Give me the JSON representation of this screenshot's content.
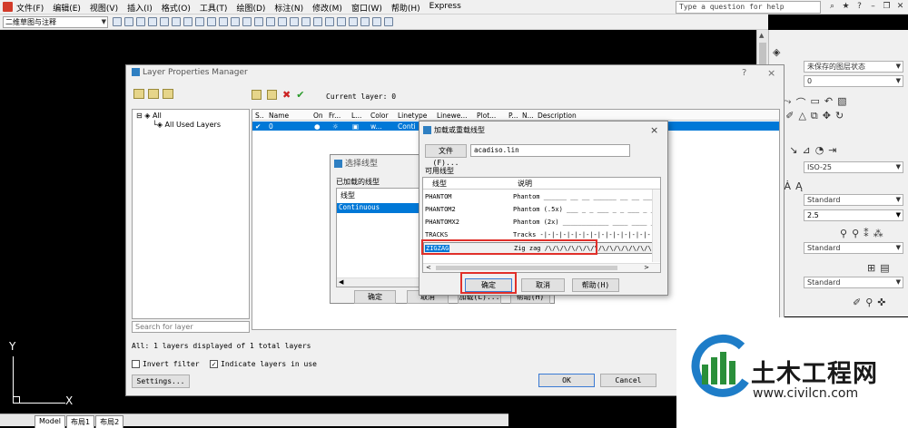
{
  "menubar": {
    "items": [
      "文件(F)",
      "编辑(E)",
      "视图(V)",
      "插入(I)",
      "格式(O)",
      "工具(T)",
      "绘图(D)",
      "标注(N)",
      "修改(M)",
      "窗口(W)",
      "帮助(H)",
      "Express"
    ],
    "help_placeholder": "Type a question for help"
  },
  "toolbar": {
    "workspace": "二维草图与注释"
  },
  "layout_tabs": [
    "Model",
    "布局1",
    "布局2"
  ],
  "axis": {
    "y": "Y",
    "x": "X"
  },
  "right_panel": {
    "layer_state": "未保存的图层状态",
    "layer_value": "0",
    "dim_style": "ISO-25",
    "text_style": "Standard",
    "text_height": "2.5",
    "mleader_style": "Standard",
    "table_style": "Standard"
  },
  "layer_manager": {
    "title": "Layer Properties Manager",
    "help": "?",
    "close": "×",
    "current_layer": "Current layer: 0",
    "tree": {
      "root": "All",
      "child": "All Used Layers"
    },
    "columns": [
      "S..",
      "Name",
      "On",
      "Fr...",
      "L...",
      "Color",
      "Linetype",
      "Linewe...",
      "Plot...",
      "P...",
      "N...",
      "Description"
    ],
    "row": {
      "name": "0",
      "color": "w...",
      "linetype": "Conti"
    },
    "search_placeholder": "Search for layer",
    "status": "All: 1 layers displayed of 1 total layers",
    "invert_filter": "Invert filter",
    "indicate_layers": "Indicate layers in use",
    "settings": "Settings...",
    "ok": "OK",
    "cancel": "Cancel"
  },
  "select_linetype": {
    "title": "选择线型",
    "loaded_label": "已加载的线型",
    "col": "线型",
    "item": "Continuous",
    "buttons": [
      "确定",
      "取消",
      "加载(L)...",
      "帮助(H)"
    ]
  },
  "load_linetype": {
    "title": "加载或重载线型",
    "close": "×",
    "file_button": "文件(F)...",
    "file_name": "acadiso.lin",
    "available": "可用线型",
    "col_linetype": "线型",
    "col_desc": "说明",
    "rows": [
      {
        "name": "PHANTOM",
        "desc": "Phantom ______ __ __ ______ __ __ ______"
      },
      {
        "name": "PHANTOM2",
        "desc": "Phantom (.5x) ___ _ _ ___ _ _ ___ _ _ ___"
      },
      {
        "name": "PHANTOMX2",
        "desc": "Phantom (2x) ____________ ____ ____ ______"
      },
      {
        "name": "TRACKS",
        "desc": "Tracks -|-|-|-|-|-|-|-|-|-|-|-|-|-|-|-|-|-|-|-|-|-"
      },
      {
        "name": "ZIGZAG",
        "desc": "Zig zag /\\/\\/\\/\\/\\/\\/\\/\\/\\/\\/\\/\\/\\/\\/\\/\\/\\/\\"
      }
    ],
    "ok": "确定",
    "cancel": "取消",
    "help": "帮助(H)"
  },
  "watermark": {
    "title": "土木工程网",
    "url": "www.civilcn.com"
  }
}
